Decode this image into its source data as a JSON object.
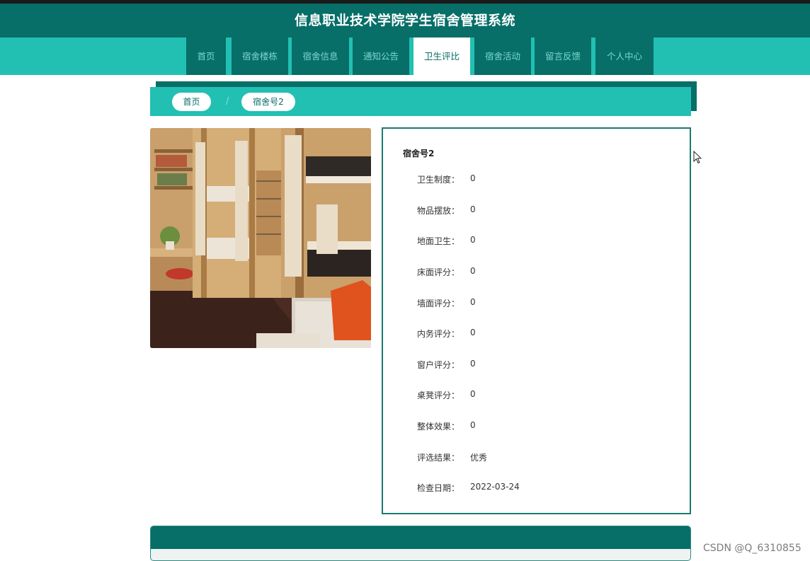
{
  "header": {
    "title": "信息职业技术学院学生宿舍管理系统"
  },
  "nav": {
    "items": [
      "首页",
      "宿舍楼栋",
      "宿舍信息",
      "通知公告",
      "卫生评比",
      "宿舍活动",
      "留言反馈",
      "个人中心"
    ],
    "active": "卫生评比"
  },
  "breadcrumb": {
    "home": "首页",
    "separator": "/",
    "current": "宿舍号2"
  },
  "detail": {
    "title": "宿舍号2",
    "fields": [
      {
        "label": "卫生制度：",
        "value": "0"
      },
      {
        "label": "物品摆放：",
        "value": "0"
      },
      {
        "label": "地面卫生：",
        "value": "0"
      },
      {
        "label": "床面评分：",
        "value": "0"
      },
      {
        "label": "墙面评分：",
        "value": "0"
      },
      {
        "label": "内务评分：",
        "value": "0"
      },
      {
        "label": "窗户评分：",
        "value": "0"
      },
      {
        "label": "桌凳评分：",
        "value": "0"
      },
      {
        "label": "整体效果：",
        "value": "0"
      },
      {
        "label": "评选结果：",
        "value": "优秀"
      },
      {
        "label": "检查日期：",
        "value": "2022-03-24"
      }
    ]
  },
  "watermark": "CSDN @Q_6310855",
  "colors": {
    "primary_dark": "#076e68",
    "primary_light": "#22c0b3"
  }
}
